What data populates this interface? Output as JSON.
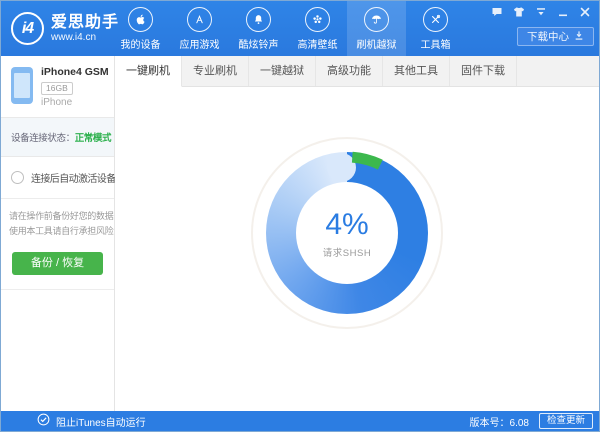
{
  "brand": {
    "logo_text": "i4",
    "name": "爱思助手",
    "site": "www.i4.cn"
  },
  "topbar": {
    "nav": [
      {
        "label": "我的设备",
        "icon": "apple-icon"
      },
      {
        "label": "应用游戏",
        "icon": "appstore-icon"
      },
      {
        "label": "酷炫铃声",
        "icon": "bell-icon"
      },
      {
        "label": "高清壁纸",
        "icon": "wallpaper-icon"
      },
      {
        "label": "刷机越狱",
        "icon": "jailbreak-icon",
        "selected": true
      },
      {
        "label": "工具箱",
        "icon": "toolbox-icon"
      }
    ],
    "download_center": "下载中心",
    "window_controls": [
      {
        "icon": "feedback-icon"
      },
      {
        "icon": "skin-icon"
      },
      {
        "icon": "menu-icon"
      },
      {
        "icon": "minimize-icon"
      },
      {
        "icon": "close-icon"
      }
    ]
  },
  "sidebar": {
    "device": {
      "name": "iPhone4 GSM",
      "capacity": "16GB",
      "family": "iPhone"
    },
    "status": {
      "label": "设备连接状态：",
      "value": "正常模式",
      "value_color": "#2eb14e"
    },
    "auto_activate_label": "连接后自动激活设备",
    "warning": {
      "line1": "请在操作前备份好您的数据",
      "line2": "使用本工具请自行承担风险"
    },
    "backup_button": "备份 / 恢复"
  },
  "tabs": [
    {
      "label": "一键刷机",
      "selected": true
    },
    {
      "label": "专业刷机"
    },
    {
      "label": "一键越狱"
    },
    {
      "label": "高级功能"
    },
    {
      "label": "其他工具"
    },
    {
      "label": "固件下载"
    }
  ],
  "progress": {
    "percent": "4%",
    "value": 4,
    "status": "请求SHSH",
    "ring_color": "#2e7fe3",
    "arc_color": "#3cb84d",
    "text_color": "#2a7ce2"
  },
  "statusbar": {
    "block_itunes": "阻止iTunes自动运行",
    "version": "版本号：6.08",
    "check_update": "检查更新"
  },
  "colors": {
    "accent_blue": "#2c7de2",
    "green": "#47b44b"
  }
}
